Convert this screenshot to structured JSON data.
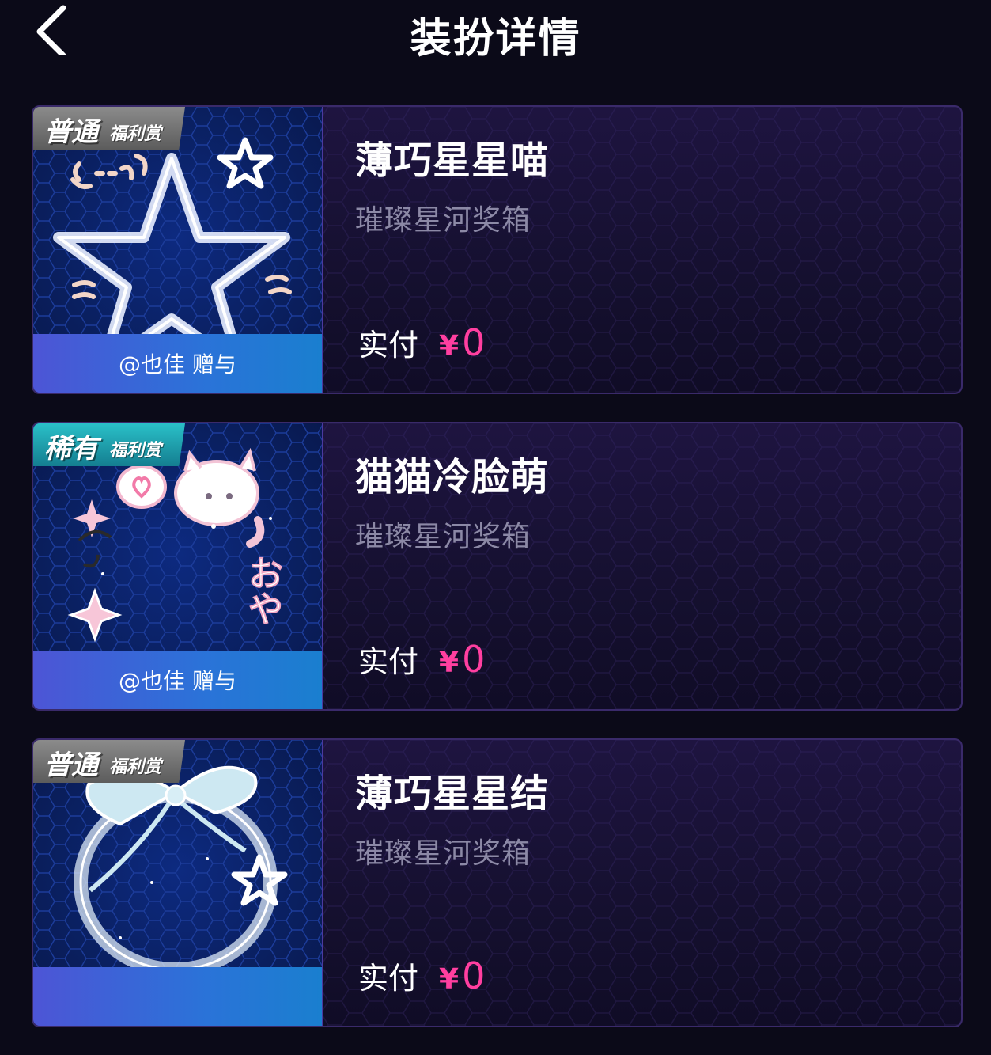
{
  "header": {
    "title": "装扮详情"
  },
  "items": [
    {
      "badge_main": "普通",
      "badge_sub": "福利赏",
      "badge_type": "common",
      "gift_text": "@也佳 赠与",
      "name": "薄巧星星喵",
      "source": "璀璨星河奖箱",
      "price_label": "实付",
      "currency": "¥",
      "price": "0"
    },
    {
      "badge_main": "稀有",
      "badge_sub": "福利赏",
      "badge_type": "rare",
      "gift_text": "@也佳 赠与",
      "name": "猫猫冷脸萌",
      "source": "璀璨星河奖箱",
      "price_label": "实付",
      "currency": "¥",
      "price": "0"
    },
    {
      "badge_main": "普通",
      "badge_sub": "福利赏",
      "badge_type": "common",
      "gift_text": "",
      "name": "薄巧星星结",
      "source": "璀璨星河奖箱",
      "price_label": "实付",
      "currency": "¥",
      "price": "0"
    }
  ],
  "colors": {
    "background": "#0b0a18",
    "price": "#ff3fa0",
    "badge_common": "#6e6e6e",
    "badge_rare": "#1fa3b3",
    "gift_bar": "#2f6fd8"
  },
  "icons": {
    "back": "chevron-left-icon"
  }
}
